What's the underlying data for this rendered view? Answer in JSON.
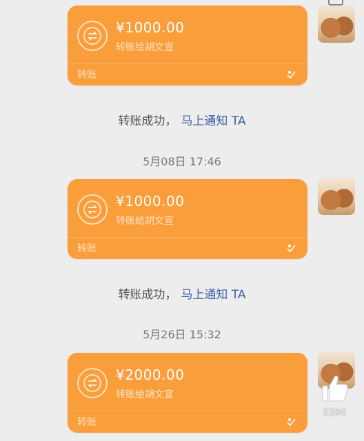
{
  "transfers": [
    {
      "amount": "¥1000.00",
      "description": "转账给胡文宣",
      "label": "转账"
    },
    {
      "amount": "¥1000.00",
      "description": "转账给胡文宣",
      "label": "转账"
    },
    {
      "amount": "¥2000.00",
      "description": "转账给胡文宣",
      "label": "转账"
    }
  ],
  "status_messages": [
    {
      "text": "转账成功，",
      "link": "马上通知 TA"
    },
    {
      "text": "转账成功，",
      "link": "马上通知 TA"
    }
  ],
  "timestamps": [
    "5月08日 17:46",
    "5月26日 15:32"
  ],
  "like_count": "5394",
  "colors": {
    "card": "#fa9d3b",
    "link": "#3a5fa8",
    "background": "#ededed"
  },
  "icons": [
    "transfer-icon",
    "wechat-pay-icon",
    "avatar",
    "thumbs-up-icon"
  ]
}
